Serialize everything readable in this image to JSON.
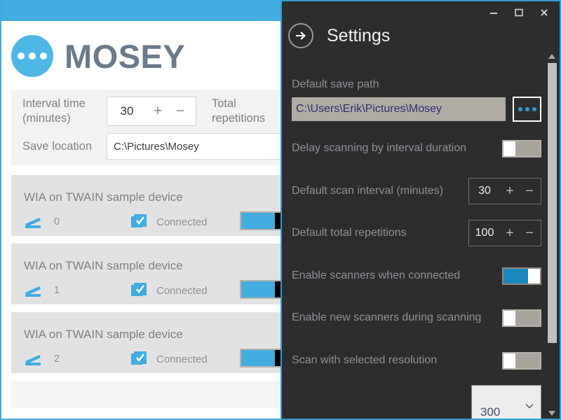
{
  "main_window": {
    "brand": {
      "name": "MOSEY",
      "icon": "three-dots-circle-icon"
    },
    "form": {
      "interval_label": "Interval time (minutes)",
      "interval_value": "30",
      "plus_label": "+",
      "minus_label": "−",
      "total_repetitions_label": "Total repetitions",
      "save_location_label": "Save location",
      "save_location_value": "C:\\Pictures\\Mosey"
    },
    "scanners": [
      {
        "name": "WIA on TWAIN sample device",
        "index": "0",
        "status": "Connected",
        "enabled": true,
        "scanner_icon": "scanner-icon",
        "status_icon": "checkbox-checked-icon"
      },
      {
        "name": "WIA on TWAIN sample device",
        "index": "1",
        "status": "Connected",
        "enabled": true,
        "scanner_icon": "scanner-icon",
        "status_icon": "checkbox-checked-icon"
      },
      {
        "name": "WIA on TWAIN sample device",
        "index": "2",
        "status": "Connected",
        "enabled": true,
        "scanner_icon": "scanner-icon",
        "status_icon": "checkbox-checked-icon"
      }
    ]
  },
  "settings_window": {
    "title": "Settings",
    "back_icon": "arrow-right-circle-icon",
    "window_controls": {
      "minimize": "minimize-icon",
      "maximize": "maximize-icon",
      "close": "close-icon"
    },
    "default_save_path": {
      "label": "Default save path",
      "value": "C:\\Users\\Erik\\Pictures\\Mosey",
      "browse_label": "•••"
    },
    "rows": [
      {
        "label": "Delay scanning by interval duration",
        "type": "toggle",
        "on": false
      },
      {
        "label": "Default scan interval (minutes)",
        "type": "stepper",
        "value": "30"
      },
      {
        "label": "Default total repetitions",
        "type": "stepper",
        "value": "100"
      },
      {
        "label": "Enable scanners when connected",
        "type": "toggle",
        "on": true
      },
      {
        "label": "Enable new scanners during scanning",
        "type": "toggle",
        "on": false
      },
      {
        "label": "Scan with selected resolution",
        "type": "toggle",
        "on": false
      }
    ],
    "stepper_plus": "+",
    "stepper_minus": "−",
    "resolution_select": {
      "value": "300",
      "chevron": "ˇ"
    },
    "scrollbar": {
      "up": "▲",
      "down": "▼"
    }
  },
  "colors": {
    "accent_blue": "#41ADE0",
    "settings_bg": "#2d2d2d",
    "toggle_on": "#1b87bf",
    "toggle_off": "#b0aca4",
    "label_grey": "#8a9199"
  }
}
